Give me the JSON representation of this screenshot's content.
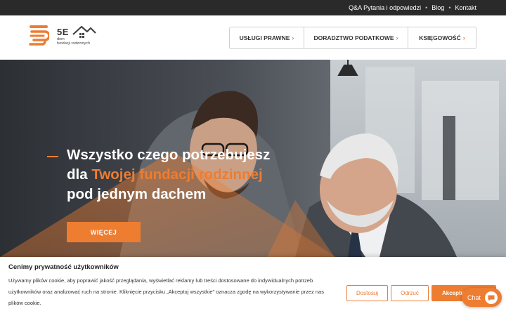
{
  "topbar": {
    "links": [
      "Q&A Pytania i odpowiedzi",
      "Blog",
      "Kontakt"
    ]
  },
  "logo": {
    "code": "5E",
    "sub_line1": "dom",
    "sub_line2": "fundacji rodzinnych"
  },
  "nav": {
    "items": [
      "USŁUGI PRAWNE",
      "DORADZTWO PODATKOWE",
      "KSIĘGOWOŚĆ"
    ],
    "chevron": "›"
  },
  "hero": {
    "line1": "Wszystko czego potrzebujesz",
    "line2_prefix": "dla ",
    "line2_accent": "Twojej fundacji rodzinnej",
    "line3": "pod jednym dachem",
    "button": "WIĘCEJ"
  },
  "cookie": {
    "title": "Cenimy prywatność użytkowników",
    "text": "Używamy plików cookie, aby poprawić jakość przeglądania, wyświetlać reklamy lub treści dostosowane do indywidualnych potrzeb użytkowników oraz analizować ruch na stronie. Kliknięcie przycisku „Akceptuj wszystkie” oznacza zgodę na wykorzystywanie przez nas plików cookie.",
    "customize": "Dostosuj",
    "reject": "Odrzuć",
    "accept": "Akceptuj"
  },
  "chat": {
    "label": "Chat"
  },
  "colors": {
    "accent": "#ed7d31",
    "topbar": "#2a2a2a",
    "text_dark": "#333333"
  },
  "icons": {
    "logo_mark": "stacked-lines-logo-icon",
    "house": "house-roof-icon",
    "chevron": "chevron-right-icon",
    "chat": "chat-bubble-icon"
  }
}
